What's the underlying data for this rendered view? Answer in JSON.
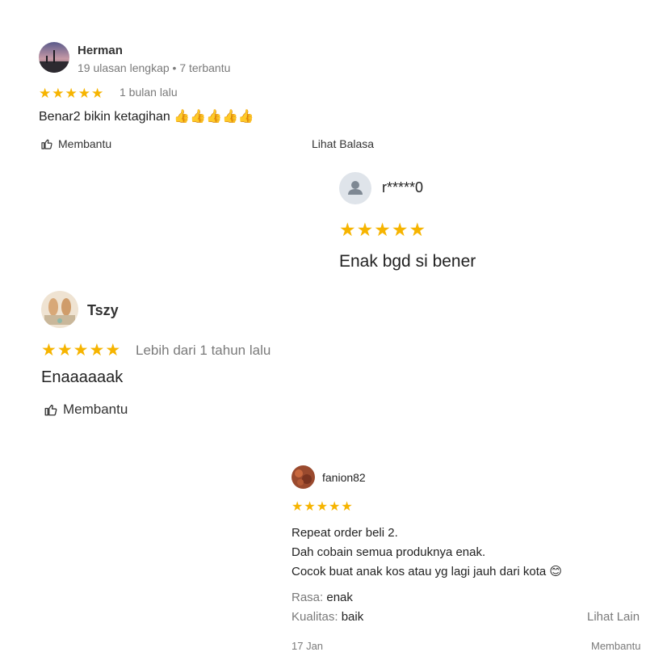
{
  "review1": {
    "name": "Herman",
    "meta": "19 ulasan lengkap • 7 terbantu",
    "rating": 5,
    "time": "1 bulan lalu",
    "text": "Benar2 bikin ketagihan 👍👍👍👍👍",
    "helpful_label": "Membantu",
    "replies_label": "Lihat Balasa",
    "star_color": "#f6b400"
  },
  "review2": {
    "name": "r*****0",
    "rating": 5,
    "text": "Enak bgd si bener"
  },
  "review3": {
    "name": "Tszy",
    "rating": 5,
    "time": "Lebih dari 1 tahun lalu",
    "text": "Enaaaaaak",
    "helpful_label": "Membantu"
  },
  "review4": {
    "name": "fanion82",
    "rating": 5,
    "lines": [
      "Repeat order beli 2.",
      "Dah cobain semua produknya enak.",
      "Cocok buat anak kos atau yg lagi jauh dari kota 😊"
    ],
    "attr1_label": "Rasa:",
    "attr1_value": "enak",
    "attr2_label": "Kualitas:",
    "attr2_value": "baik",
    "more_label": "Lihat Lain",
    "footer_left": "17 Jan",
    "footer_right": "Membantu"
  }
}
